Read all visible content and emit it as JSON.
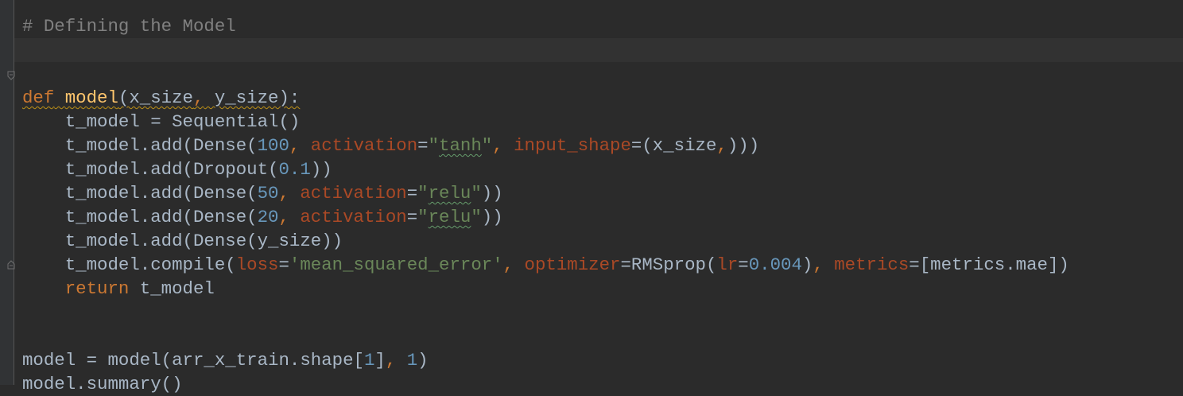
{
  "editor": {
    "language": "python",
    "colors": {
      "background": "#2b2b2b",
      "gutter": "#313335",
      "current_line": "#323232",
      "comment": "#808080",
      "keyword": "#cc7832",
      "function_name": "#ffc66d",
      "number": "#6897bb",
      "string": "#6a8759",
      "keyword_argument": "#aa4926",
      "default_text": "#a9b7c6"
    },
    "fold_icons": [
      "fold-open-icon",
      "fold-close-icon"
    ]
  },
  "code": {
    "l1": {
      "t0": "# Defining the Model"
    },
    "l3": {
      "t0": "def",
      "t1": " ",
      "t2": "model",
      "t3": "(x_size",
      "t4": ",",
      "t5": " y_size):"
    },
    "l4": {
      "t0": "    t_model = Sequential()"
    },
    "l5": {
      "t0": "    t_model.add(Dense(",
      "t1": "100",
      "t2": ", ",
      "t3": "activation",
      "t4": "=",
      "t5": "\"",
      "t6": "tanh",
      "t7": "\"",
      "t8": ", ",
      "t9": "input_shape",
      "t10": "=(x_size",
      "t11": ",",
      "t12": ")))"
    },
    "l6": {
      "t0": "    t_model.add(Dropout(",
      "t1": "0.1",
      "t2": "))"
    },
    "l7": {
      "t0": "    t_model.add(Dense(",
      "t1": "50",
      "t2": ", ",
      "t3": "activation",
      "t4": "=",
      "t5": "\"",
      "t6": "relu",
      "t7": "\"",
      "t8": "))"
    },
    "l8": {
      "t0": "    t_model.add(Dense(",
      "t1": "20",
      "t2": ", ",
      "t3": "activation",
      "t4": "=",
      "t5": "\"",
      "t6": "relu",
      "t7": "\"",
      "t8": "))"
    },
    "l9": {
      "t0": "    t_model.add(Dense(y_size))"
    },
    "l10": {
      "t0": "    t_model.compile(",
      "t1": "loss",
      "t2": "=",
      "t3": "'mean_squared_error'",
      "t4": ", ",
      "t5": "optimizer",
      "t6": "=RMSprop(",
      "t7": "lr",
      "t8": "=",
      "t9": "0.004",
      "t10": ")",
      "t11": ", ",
      "t12": "metrics",
      "t13": "=[metrics.mae])"
    },
    "l11": {
      "t0": "    ",
      "t1": "return",
      "t2": " t_model"
    },
    "l14": {
      "t0": "model = model(arr_x_train.shape[",
      "t1": "1",
      "t2": "]",
      "t3": ", ",
      "t4": "1",
      "t5": ")"
    },
    "l15": {
      "t0": "model.summary()"
    }
  }
}
